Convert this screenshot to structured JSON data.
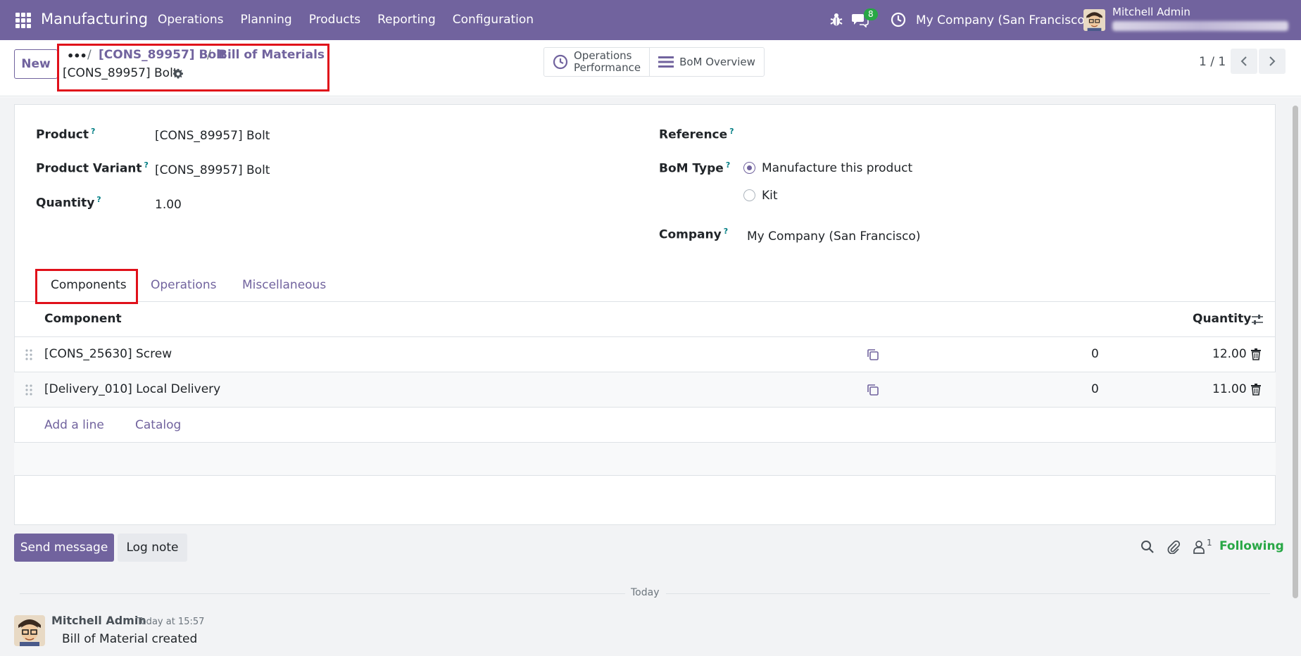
{
  "navbar": {
    "app_name": "Manufacturing",
    "menu": [
      "Operations",
      "Planning",
      "Products",
      "Reporting",
      "Configuration"
    ],
    "chat_count": "8",
    "company": "My Company (San Francisco)",
    "user": "Mitchell Admin"
  },
  "control": {
    "new_label": "New",
    "breadcrumb_dots": "•••",
    "breadcrumb": [
      "[CONS_89957] Bolt",
      "Bill of Materials"
    ],
    "record_title": "[CONS_89957] Bolt",
    "smart_buttons": {
      "operations_line1": "Operations",
      "operations_line2": "Performance",
      "bom_overview": "BoM Overview"
    },
    "pager": "1 / 1"
  },
  "form": {
    "product_label": "Product",
    "product_value": "[CONS_89957] Bolt",
    "variant_label": "Product Variant",
    "variant_value": "[CONS_89957] Bolt",
    "quantity_label": "Quantity",
    "quantity_value": "1.00",
    "reference_label": "Reference",
    "bom_type_label": "BoM Type",
    "bom_type_options": [
      "Manufacture this product",
      "Kit"
    ],
    "bom_type_selected": "Manufacture this product",
    "company_label": "Company",
    "company_value": "My Company (San Francisco)",
    "help_mark": "?"
  },
  "tabs": [
    "Components",
    "Operations",
    "Miscellaneous"
  ],
  "components": {
    "col_component": "Component",
    "col_quantity": "Quantity",
    "rows": [
      {
        "component": "[CONS_25630] Screw",
        "avail": "0",
        "quantity": "12.00"
      },
      {
        "component": "[Delivery_010] Local Delivery",
        "avail": "0",
        "quantity": "11.00"
      }
    ],
    "add_line": "Add a line",
    "catalog": "Catalog"
  },
  "chatter": {
    "send_message": "Send message",
    "log_note": "Log note",
    "follower_count": "1",
    "following": "Following",
    "today": "Today",
    "author": "Mitchell Admin",
    "time": "Today at 15:57",
    "body": "Bill of Material created"
  },
  "colors": {
    "brand": "#71639e",
    "highlight": "#e0101a",
    "following": "#28a745"
  }
}
